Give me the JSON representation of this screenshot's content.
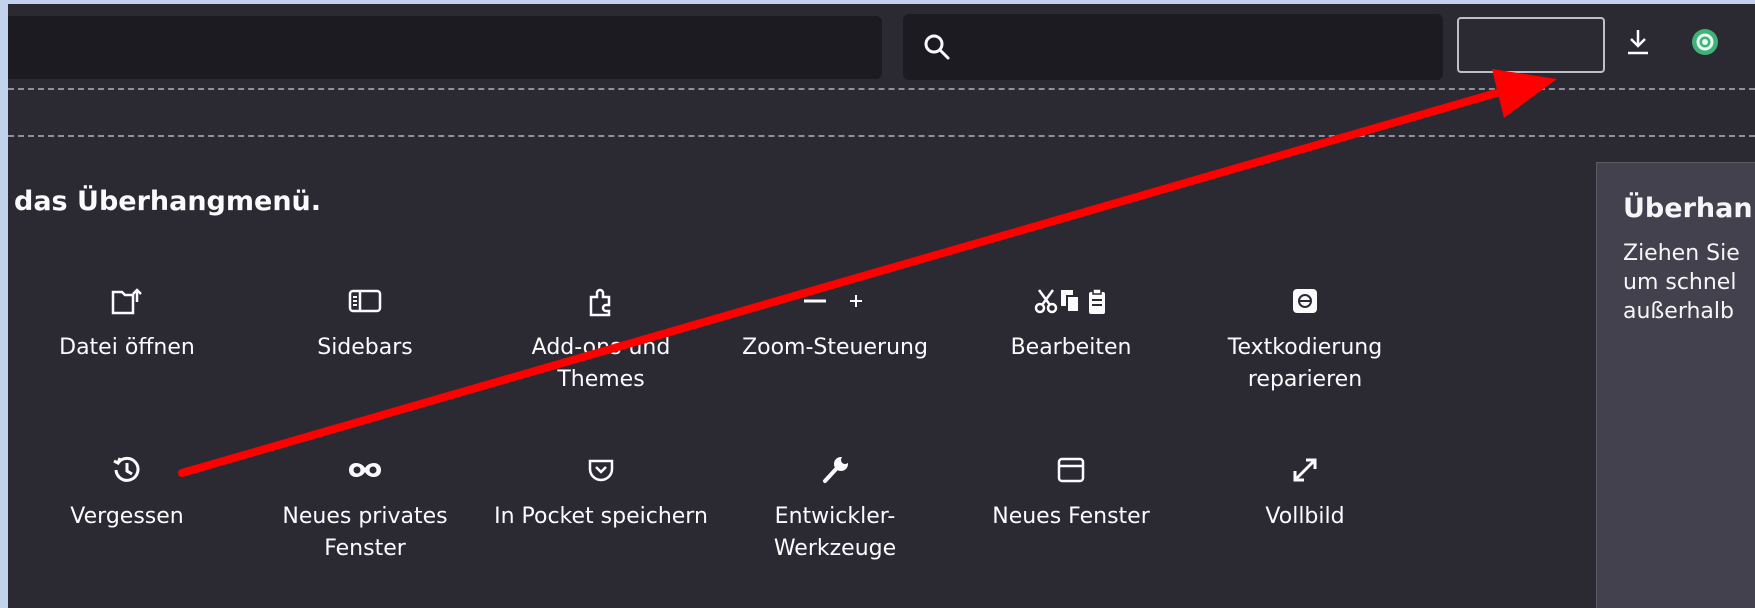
{
  "toolbar": {
    "search_placeholder": "",
    "icons": [
      "search-icon",
      "download-icon",
      "extension-icon"
    ]
  },
  "customize": {
    "heading": "das Überhangmenü.",
    "row1": [
      {
        "icon": "open-file-icon",
        "label": "Datei öffnen"
      },
      {
        "icon": "sidebars-icon",
        "label": "Sidebars"
      },
      {
        "icon": "puzzle-icon",
        "label": "Add-ons und Themes"
      },
      {
        "icon": "zoom-icon",
        "label": "Zoom-Steuerung"
      },
      {
        "icon": "edit-icon",
        "label": "Bearbeiten"
      },
      {
        "icon": "encoding-icon",
        "label": "Textkodierung reparieren"
      }
    ],
    "row2": [
      {
        "icon": "history-icon",
        "label": "Vergessen"
      },
      {
        "icon": "mask-icon",
        "label": "Neues privates Fenster"
      },
      {
        "icon": "pocket-icon",
        "label": "In Pocket speichern"
      },
      {
        "icon": "wrench-icon",
        "label": "Entwickler-Werkzeuge"
      },
      {
        "icon": "window-icon",
        "label": "Neues Fenster"
      },
      {
        "icon": "fullscreen-icon",
        "label": "Vollbild"
      }
    ]
  },
  "overflow_panel": {
    "title": "Überhan",
    "line1": "Ziehen Sie",
    "line2": "um schnel",
    "line3": "außerhalb"
  },
  "annotation": {
    "color": "#ff0000"
  }
}
